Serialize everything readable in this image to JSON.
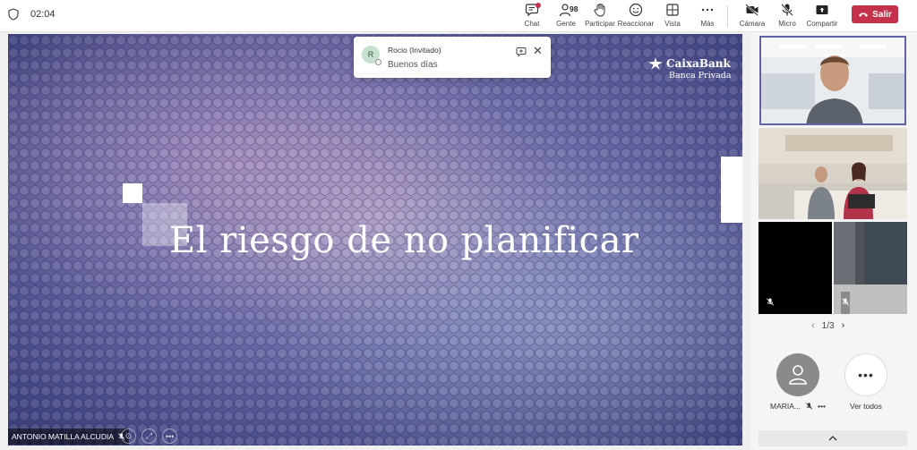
{
  "topbar": {
    "timer": "02:04",
    "tools": {
      "chat": "Chat",
      "people": "Gente",
      "people_count": "98",
      "raise": "Participar",
      "react": "Reaccionar",
      "view": "Vista",
      "more": "Más",
      "camera": "Cámara",
      "mic": "Micro",
      "share": "Compartir"
    },
    "leave_label": "Salir",
    "colors": {
      "leave": "#c4314b",
      "accent": "#6264a7"
    }
  },
  "slide": {
    "title": "El riesgo de no planificar",
    "logo_line1": "CaixaBank",
    "logo_line2": "Banca Privada",
    "presenter": "ANTONIO MATILLA ALCUDIA"
  },
  "toast": {
    "initial": "R",
    "sender": "Rocio (Invitado)",
    "message": "Buenos días"
  },
  "panel": {
    "page": "1/3",
    "participant_name": "MARIA...",
    "see_all": "Ver todos"
  }
}
